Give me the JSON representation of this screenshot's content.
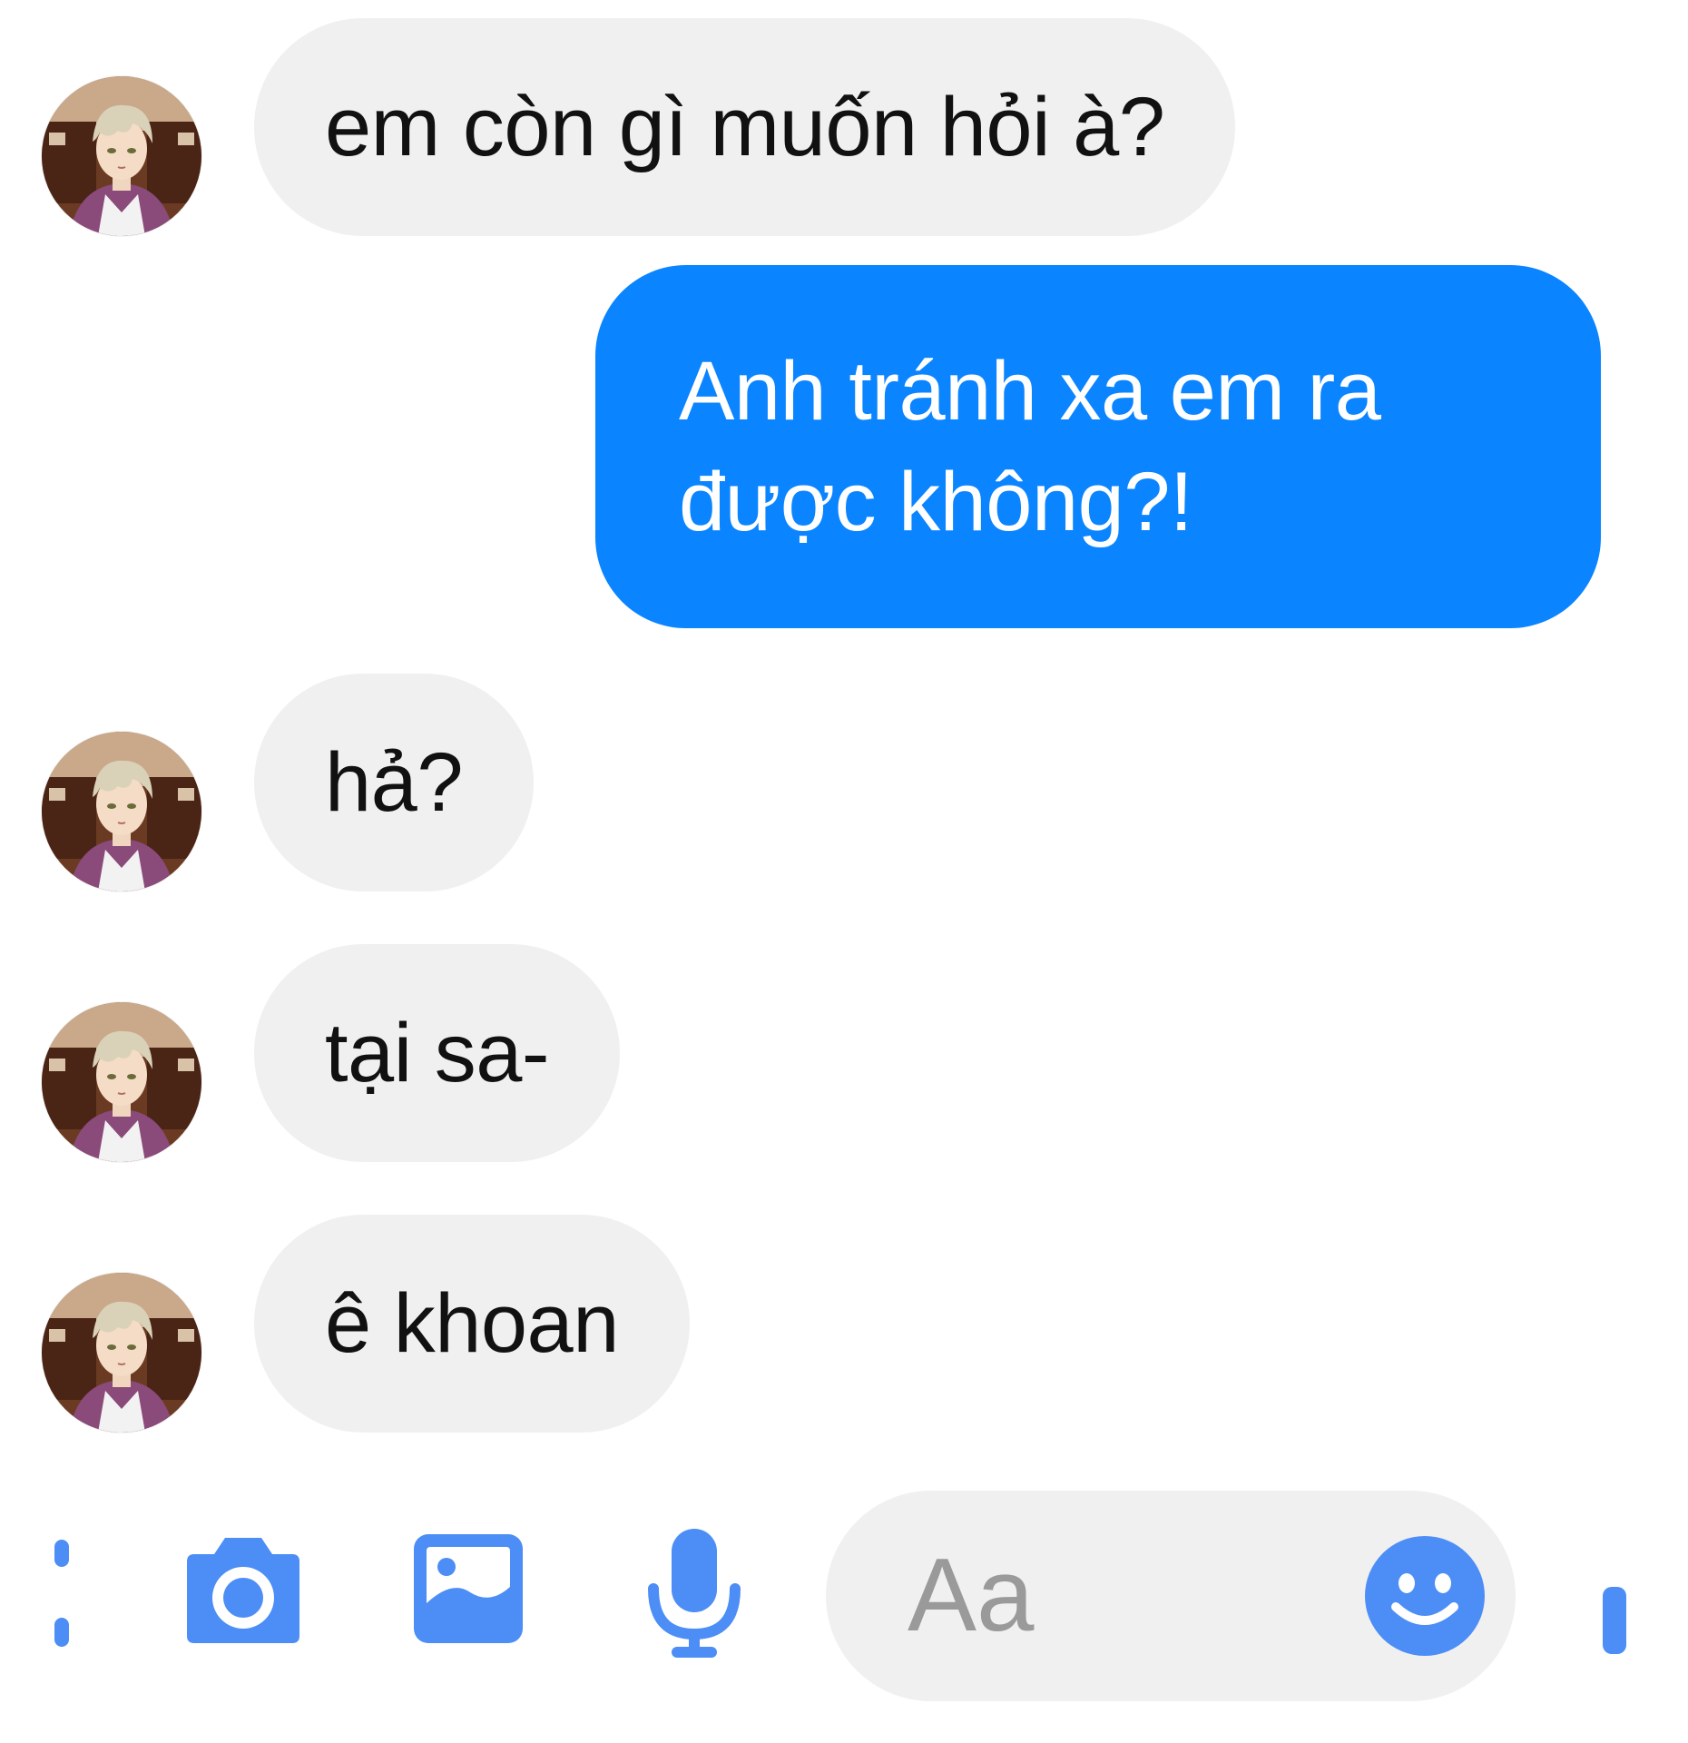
{
  "messages": [
    {
      "direction": "received",
      "text": "em còn gì muốn hỏi à?"
    },
    {
      "direction": "sent",
      "lines": [
        "Anh tránh xa em ra",
        "được không?!"
      ]
    },
    {
      "direction": "received",
      "text": "hả?"
    },
    {
      "direction": "received",
      "text": "tại sa-"
    },
    {
      "direction": "received",
      "text": "ê khoan"
    }
  ],
  "composer": {
    "placeholder": "Aa",
    "icons": [
      "more-icon",
      "camera-icon",
      "image-icon",
      "microphone-icon",
      "emoji-icon",
      "like-icon"
    ]
  },
  "colors": {
    "accent": "#4c8df6",
    "sent_bubble": "#0a84ff",
    "received_bubble": "#f0f0f0",
    "received_text": "#111111",
    "placeholder": "#9a9a9a"
  }
}
